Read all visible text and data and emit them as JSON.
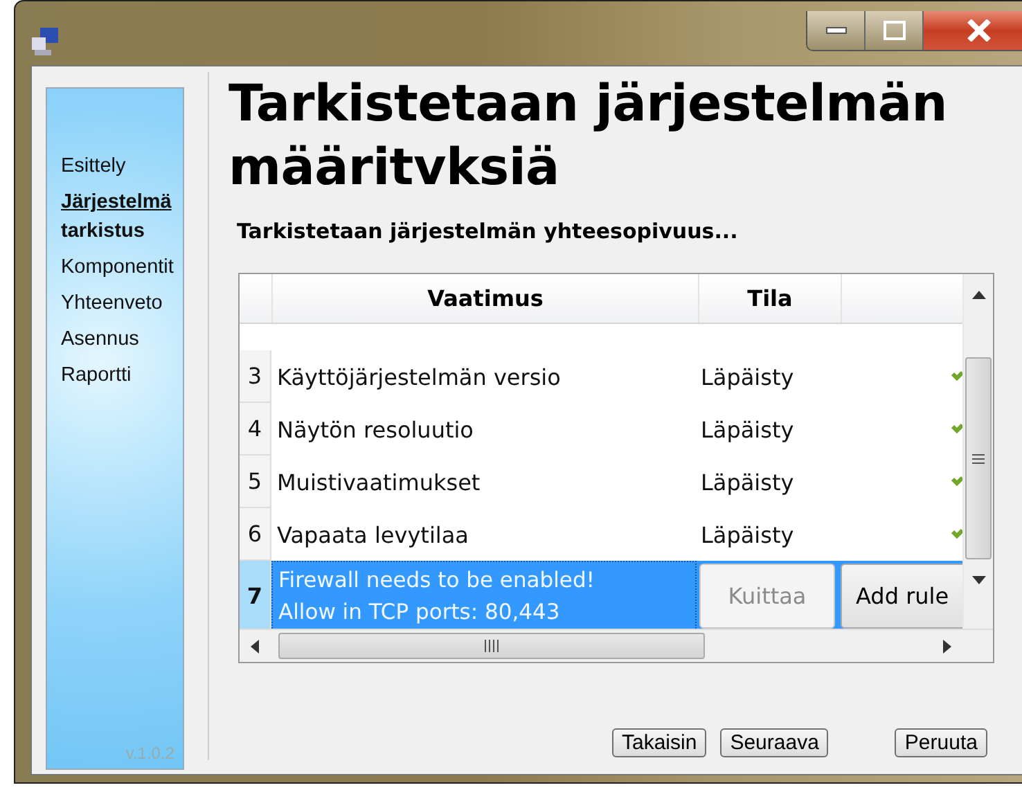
{
  "sidebar": {
    "items": [
      {
        "lines": [
          "Esittely"
        ],
        "selected": false
      },
      {
        "lines": [
          "Järjestelmä",
          "tarkistus"
        ],
        "selected": true
      },
      {
        "lines": [
          "Komponentit"
        ],
        "selected": false
      },
      {
        "lines": [
          "Yhteenveto"
        ],
        "selected": false
      },
      {
        "lines": [
          "Asennus"
        ],
        "selected": false
      },
      {
        "lines": [
          "Raportti"
        ],
        "selected": false
      }
    ],
    "version": "v.1.0.2"
  },
  "heading": {
    "title_lines": [
      "Tarkistetaan järjestelmän",
      "määritvksiä"
    ],
    "subtitle": "Tarkistetaan järjestelmän yhteesopivuus..."
  },
  "table": {
    "columns": [
      "Vaatimus",
      "Tila"
    ],
    "rows": [
      {
        "number": "3",
        "lines": [
          "Käyttöjärjestelmän versio"
        ],
        "status": "Läpäisty",
        "passed": true,
        "selected": false
      },
      {
        "number": "4",
        "lines": [
          "Näytön resoluutio"
        ],
        "status": "Läpäisty",
        "passed": true,
        "selected": false
      },
      {
        "number": "5",
        "lines": [
          "Muistivaatimukset"
        ],
        "status": "Läpäisty",
        "passed": true,
        "selected": false
      },
      {
        "number": "6",
        "lines": [
          "Vapaata levytilaa"
        ],
        "status": "Läpäisty",
        "passed": true,
        "selected": false
      },
      {
        "number": "7",
        "lines": [
          "Firewall needs to be enabled!",
          "Allow in TCP ports: 80,443"
        ],
        "passed": false,
        "selected": true,
        "actions": [
          {
            "label": "Kuittaa",
            "disabled": true
          },
          {
            "label": "Add rule",
            "disabled": false
          }
        ]
      }
    ]
  },
  "buttons": [
    {
      "label": "Takaisin"
    },
    {
      "label": "Seuraava"
    },
    {
      "label": "Peruuta"
    }
  ]
}
